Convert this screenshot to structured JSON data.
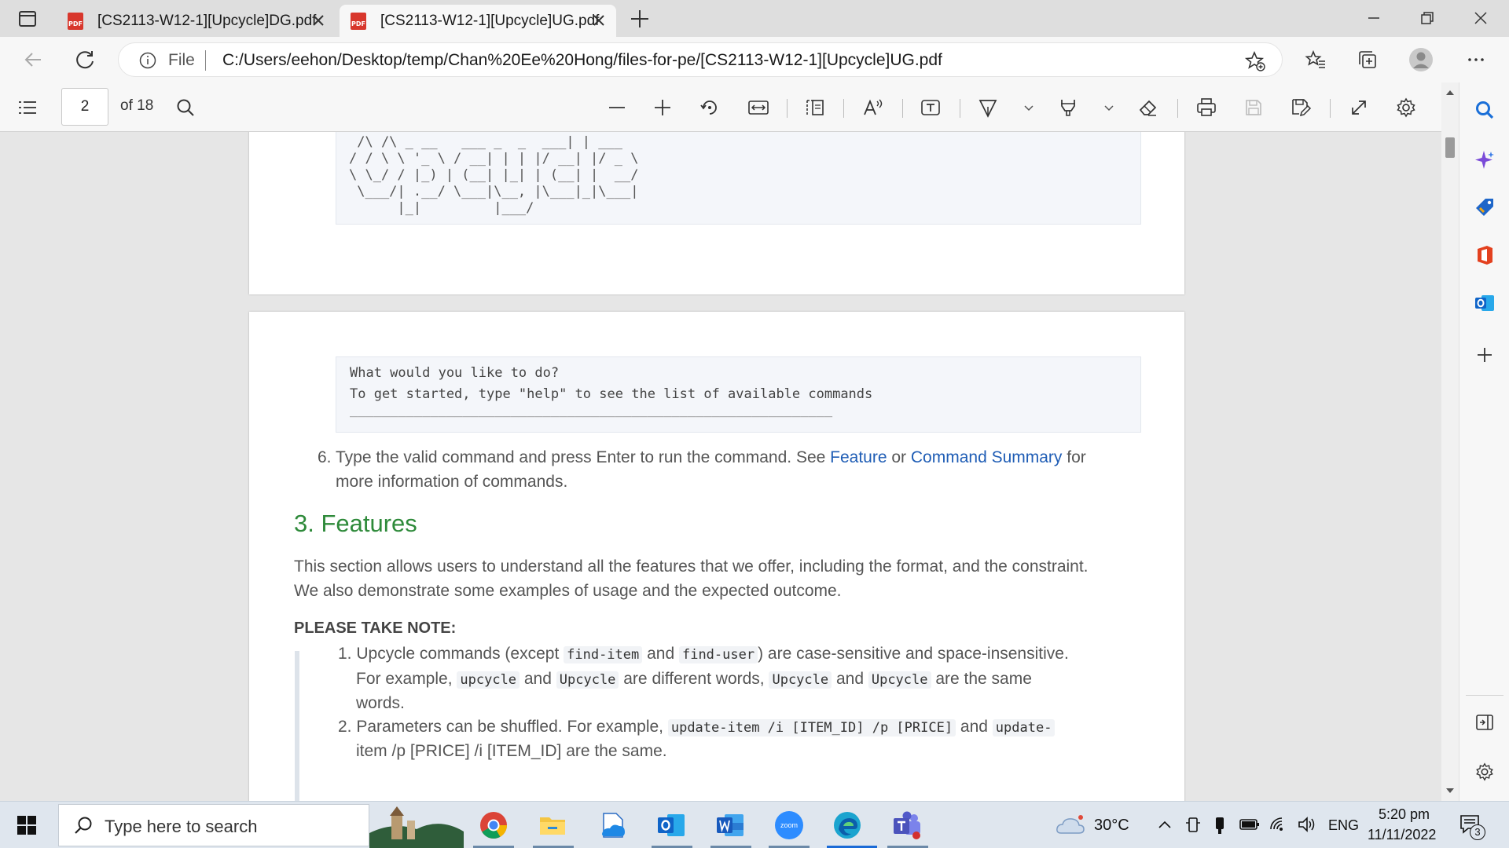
{
  "tabs": [
    {
      "title": "[CS2113-W12-1][Upcycle]DG.pdf",
      "badge": "PDF",
      "active": false
    },
    {
      "title": "[CS2113-W12-1][Upcycle]UG.pdf",
      "badge": "PDF",
      "active": true
    }
  ],
  "address": {
    "scheme_label": "File",
    "url": "C:/Users/eehon/Desktop/temp/Chan%20Ee%20Hong/files-for-pe/[CS2113-W12-1][Upcycle]UG.pdf"
  },
  "pdf_toolbar": {
    "page_number": "2",
    "page_total": "of 18"
  },
  "document": {
    "ascii_art": " /\\ /\\ _ __   ___ _  _  ___| | ___\n/ / \\ \\ '_ \\ / __| | | |/ __| |/ _ \\\n\\ \\_/ / |_) | (__| |_| | (__| |  __/\n \\___/| .__/ \\___|\\__, |\\___|_|\\___|\n      |_|         |___/",
    "console_lines": [
      "What would you like to do?",
      "To get started, type \"help\" to see the list of available commands"
    ],
    "console_rule": "____________________________________________________________",
    "step6": {
      "number": "6.",
      "text_before": "Type the valid command and press Enter to run the command. See ",
      "link1": "Feature",
      "text_mid": " or ",
      "link2": "Command Summary",
      "text_after": " for",
      "line2": "more information of commands."
    },
    "section_title": "3. Features",
    "intro_line1": "This section allows users to understand all the features that we offer, including the format, and the constraint.",
    "intro_line2": "We also demonstrate some examples of usage and the expected outcome.",
    "note_heading": "PLEASE TAKE NOTE:",
    "note1": {
      "number": "1.",
      "t1": "Upcycle commands (except ",
      "c1": "find-item",
      "t2": " and ",
      "c2": "find-user",
      "t3": ") are case-sensitive and space-insensitive.",
      "t4": "For example, ",
      "c3": "upcycle",
      "t5": " and ",
      "c4": "Upcycle",
      "t6": " are different words, ",
      "c5": "Upcycle",
      "t7": " and ",
      "c6": "Upcycle",
      "t8": " are the same",
      "t9": "words."
    },
    "note2": {
      "number": "2.",
      "t1": "Parameters can be shuffled. For example, ",
      "c1": "update-item /i [ITEM_ID] /p [PRICE]",
      "t2": " and ",
      "c2": "update-",
      "t3": "item /p [PRICE] /i [ITEM_ID] are the same."
    }
  },
  "taskbar": {
    "search_placeholder": "Type here to search",
    "weather": "30°C",
    "language": "ENG",
    "time": "5:20 pm",
    "date": "11/11/2022",
    "notification_count": "3",
    "zoom_label": "zoom"
  },
  "colors": {
    "accent_green": "#2e8a3a",
    "link_blue": "#1f5db5",
    "pdf_red": "#d8372c"
  }
}
